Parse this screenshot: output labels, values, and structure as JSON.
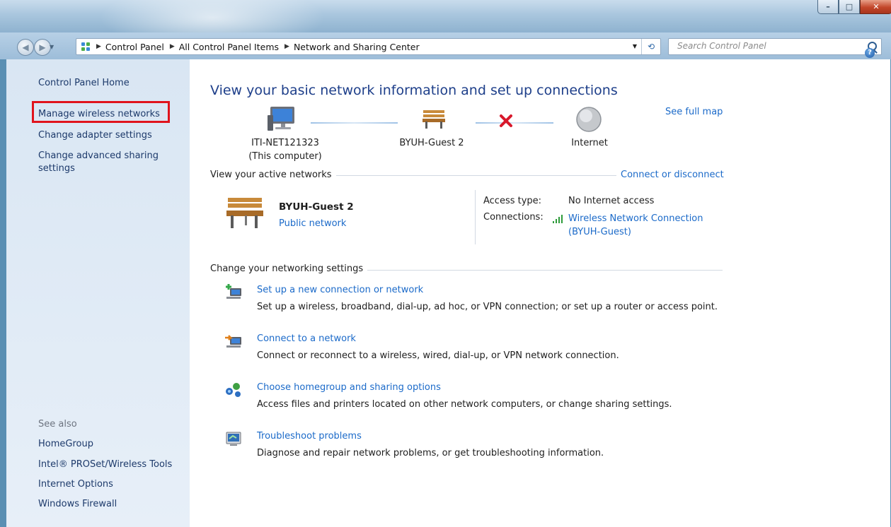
{
  "window": {
    "minimize_glyph": "–",
    "maximize_glyph": "□",
    "close_glyph": "✕"
  },
  "nav": {
    "back_glyph": "◀",
    "forward_glyph": "▶",
    "breadcrumbs": [
      "Control Panel",
      "All Control Panel Items",
      "Network and Sharing Center"
    ],
    "search_placeholder": "Search Control Panel"
  },
  "sidebar": {
    "home": "Control Panel Home",
    "links": [
      "Manage wireless networks",
      "Change adapter settings",
      "Change advanced sharing settings"
    ],
    "see_also_label": "See also",
    "see_also": [
      "HomeGroup",
      "Intel® PROSet/Wireless Tools",
      "Internet Options",
      "Windows Firewall"
    ]
  },
  "main": {
    "title": "View your basic network information and set up connections",
    "see_full_map": "See full map",
    "map": {
      "computer": "ITI-NET121323",
      "computer_sub": "(This computer)",
      "network": "BYUH-Guest  2",
      "internet": "Internet"
    },
    "active_networks_label": "View your active networks",
    "connect_or_disconnect": "Connect or disconnect",
    "active_network": {
      "name": "BYUH-Guest  2",
      "category": "Public network",
      "access_type_label": "Access type:",
      "access_type_value": "No Internet access",
      "connections_label": "Connections:",
      "connection_name_line1": "Wireless Network Connection",
      "connection_name_line2": "(BYUH-Guest)"
    },
    "change_settings_label": "Change your networking settings",
    "tasks": [
      {
        "title": "Set up a new connection or network",
        "desc": "Set up a wireless, broadband, dial-up, ad hoc, or VPN connection; or set up a router or access point.",
        "icon": "new-connection-icon"
      },
      {
        "title": "Connect to a network",
        "desc": "Connect or reconnect to a wireless, wired, dial-up, or VPN network connection.",
        "icon": "connect-network-icon"
      },
      {
        "title": "Choose homegroup and sharing options",
        "desc": "Access files and printers located on other network computers, or change sharing settings.",
        "icon": "homegroup-icon"
      },
      {
        "title": "Troubleshoot problems",
        "desc": "Diagnose and repair network problems, or get troubleshooting information.",
        "icon": "troubleshoot-icon"
      }
    ]
  },
  "colors": {
    "link": "#1b6ac9",
    "title": "#1e3f8a",
    "highlight": "#e0141d",
    "sidebar_bg": "#d9e6f3"
  }
}
